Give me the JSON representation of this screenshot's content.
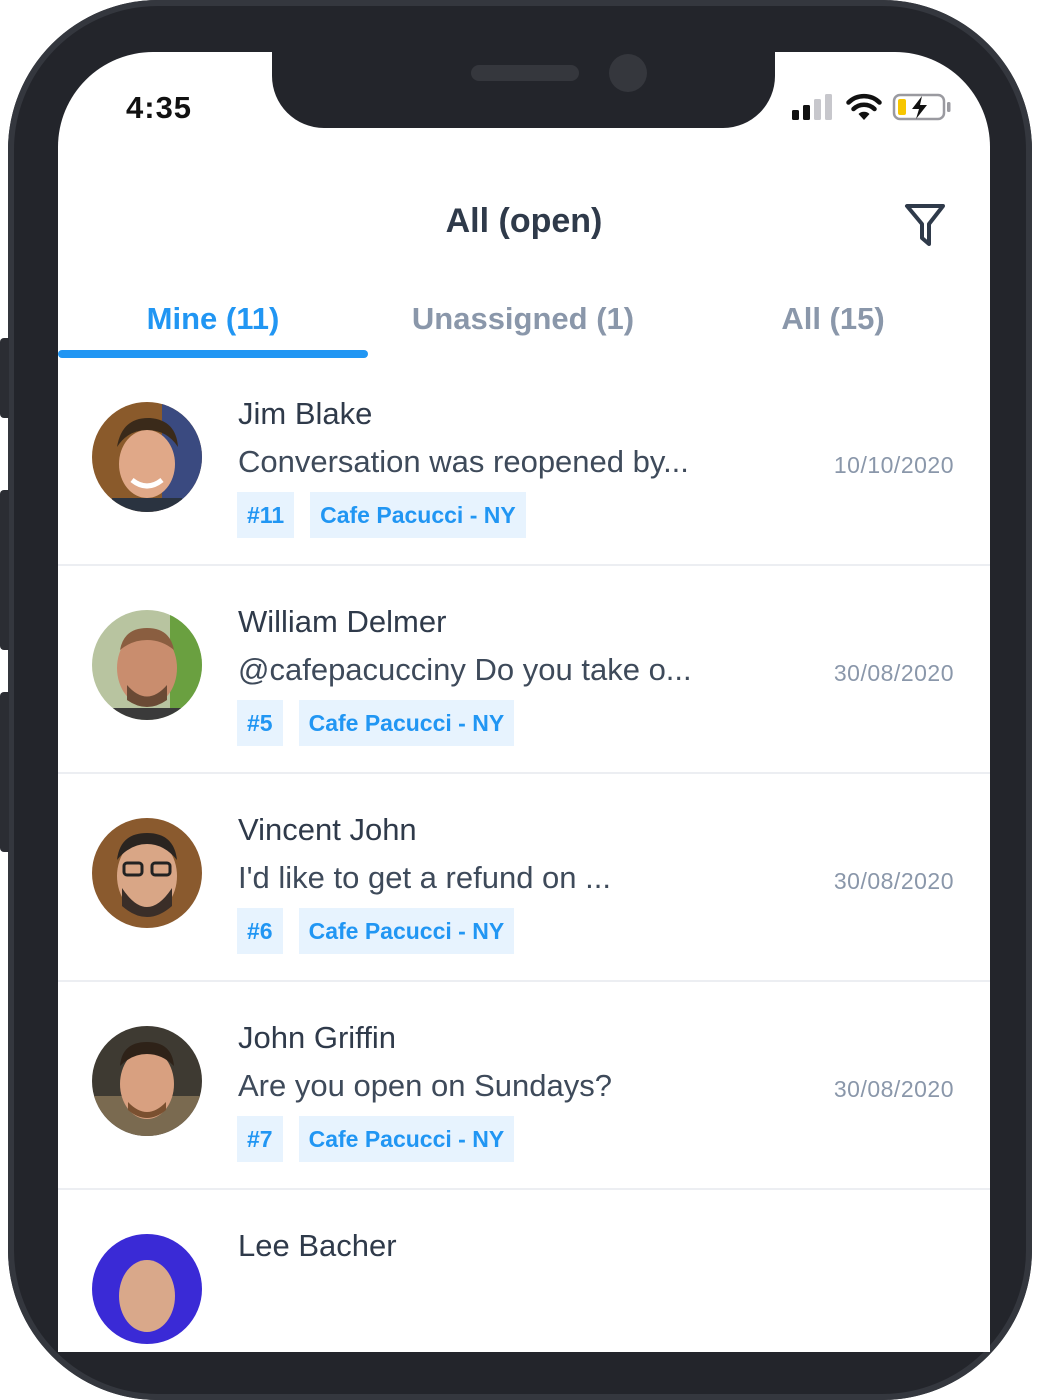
{
  "status_bar": {
    "time": "4:35"
  },
  "header": {
    "title": "All (open)",
    "filter_icon": "filter-funnel-icon"
  },
  "tabs": [
    {
      "label": "Mine (11)",
      "active": true
    },
    {
      "label": "Unassigned (1)",
      "active": false
    },
    {
      "label": "All (15)",
      "active": false
    }
  ],
  "colors": {
    "accent": "#2196f3",
    "tag_bg": "#e7f3fe",
    "muted": "#8a97aa",
    "text": "#2f3a4a"
  },
  "conversations": [
    {
      "name": "Jim Blake",
      "message": "Conversation was reopened by...",
      "date": "10/10/2020",
      "id_tag": "#11",
      "location_tag": "Cafe Pacucci - NY"
    },
    {
      "name": "William Delmer",
      "message": "@cafepacucciny Do you take o...",
      "date": "30/08/2020",
      "id_tag": "#5",
      "location_tag": "Cafe Pacucci - NY"
    },
    {
      "name": "Vincent John",
      "message": "I'd like to get a refund on ...",
      "date": "30/08/2020",
      "id_tag": "#6",
      "location_tag": "Cafe Pacucci - NY"
    },
    {
      "name": "John Griffin",
      "message": "Are you open on Sundays?",
      "date": "30/08/2020",
      "id_tag": "#7",
      "location_tag": "Cafe Pacucci - NY"
    },
    {
      "name": "Lee Bacher"
    }
  ]
}
